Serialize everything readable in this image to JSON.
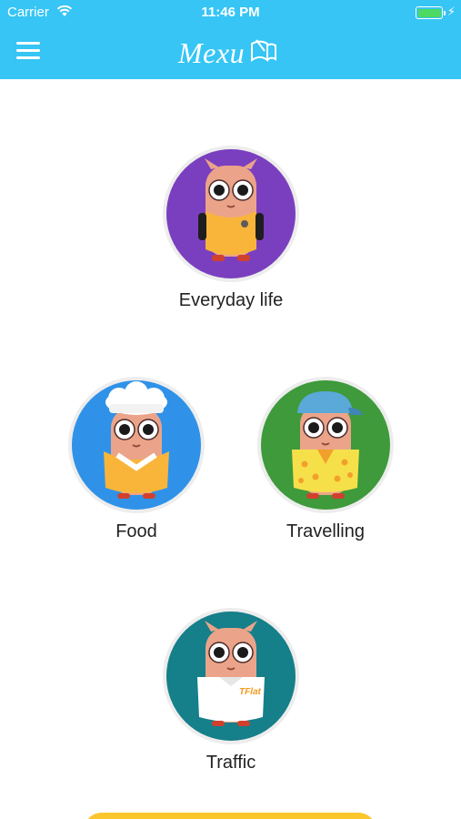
{
  "status_bar": {
    "carrier": "Carrier",
    "time": "11:46 PM",
    "battery_level": 1.0
  },
  "header": {
    "brand": "Mexu",
    "menu_icon": "hamburger-menu-icon",
    "logo_icon": "book-logo-icon",
    "background": "#36c5f5"
  },
  "categories": [
    {
      "label": "Everyday life",
      "background": "#7a3fbf",
      "icon": "mascot-everyday-icon"
    },
    {
      "label": "Food",
      "background": "#2f92e8",
      "icon": "mascot-chef-icon"
    },
    {
      "label": "Travelling",
      "background": "#3e9a3a",
      "icon": "mascot-traveller-icon"
    },
    {
      "label": "Traffic",
      "background": "#157f8a",
      "icon": "mascot-traffic-icon",
      "shirt_text": "TFlat"
    }
  ],
  "cta_color": "#fbc52c"
}
